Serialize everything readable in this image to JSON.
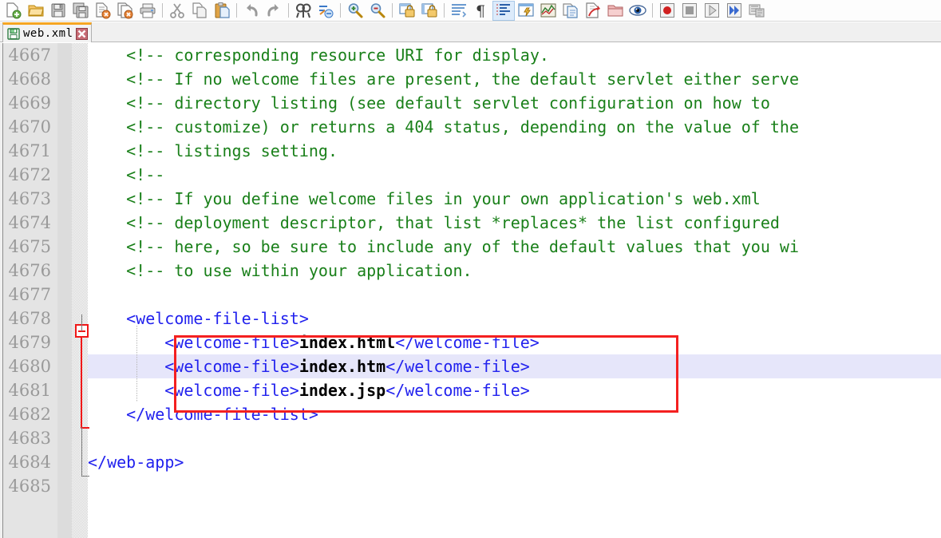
{
  "toolbar": {
    "groups": [
      {
        "buttons": [
          {
            "name": "new-file-icon",
            "title": "New"
          },
          {
            "name": "open-folder-icon",
            "title": "Open"
          },
          {
            "name": "save-icon",
            "title": "Save"
          },
          {
            "name": "save-all-icon",
            "title": "Save All"
          },
          {
            "name": "close-file-icon",
            "title": "Close"
          },
          {
            "name": "close-all-files-icon",
            "title": "Close All"
          },
          {
            "name": "print-icon",
            "title": "Print"
          }
        ]
      },
      {
        "buttons": [
          {
            "name": "cut-icon",
            "title": "Cut"
          },
          {
            "name": "copy-icon",
            "title": "Copy"
          },
          {
            "name": "paste-icon",
            "title": "Paste"
          }
        ]
      },
      {
        "buttons": [
          {
            "name": "undo-icon",
            "title": "Undo"
          },
          {
            "name": "redo-icon",
            "title": "Redo"
          }
        ]
      },
      {
        "buttons": [
          {
            "name": "find-icon",
            "title": "Find"
          },
          {
            "name": "replace-icon",
            "title": "Replace"
          }
        ]
      },
      {
        "buttons": [
          {
            "name": "zoom-in-icon",
            "title": "Zoom In"
          },
          {
            "name": "zoom-out-icon",
            "title": "Zoom Out"
          }
        ]
      },
      {
        "buttons": [
          {
            "name": "sync-vertical-scroll-icon",
            "title": "Synchronize Vertical Scrolling"
          },
          {
            "name": "sync-horizontal-scroll-icon",
            "title": "Synchronize Horizontal Scrolling"
          }
        ]
      },
      {
        "buttons": [
          {
            "name": "word-wrap-icon",
            "title": "Word wrap"
          },
          {
            "name": "show-all-characters-icon",
            "title": "Show All Characters"
          },
          {
            "name": "show-indent-guide-icon",
            "title": "Show Indent Guide",
            "selected": true
          },
          {
            "name": "user-defined-dialog-icon",
            "title": "User-Defined Dialogue"
          },
          {
            "name": "document-map-icon",
            "title": "Document Map"
          },
          {
            "name": "function-list-icon",
            "title": "Function List"
          },
          {
            "name": "document-switcher-icon",
            "title": "Document Switcher"
          },
          {
            "name": "folder-as-workspace-icon",
            "title": "Folder as Workspace"
          },
          {
            "name": "monitoring-icon",
            "title": "Monitoring"
          }
        ]
      },
      {
        "buttons": [
          {
            "name": "record-macro-icon",
            "title": "Start Recording"
          },
          {
            "name": "stop-macro-icon",
            "title": "Stop Recording"
          },
          {
            "name": "play-macro-icon",
            "title": "Playback"
          },
          {
            "name": "run-macro-multiple-icon",
            "title": "Run a Macro Multiple Times"
          },
          {
            "name": "save-macro-icon",
            "title": "Save Current Recorded Macro"
          }
        ]
      }
    ]
  },
  "tabs": [
    {
      "label": "web.xml",
      "icon": "saved-file-icon",
      "close": "close-tab-icon",
      "active": true
    }
  ],
  "editor": {
    "first_line": 4667,
    "highlighted_line": 4680,
    "annotation_box_color": "#f42020",
    "current_line_color": "#e6e6fa",
    "comment_color": "#1a801a",
    "tag_color": "#2222ee",
    "text_color": "#000000",
    "lines": [
      {
        "n": 4667,
        "indent": 0,
        "parts": [
          {
            "t": "comment",
            "s": "<!-- corresponding resource URI for display."
          }
        ]
      },
      {
        "n": 4668,
        "indent": 0,
        "parts": [
          {
            "t": "comment",
            "s": "<!-- If no welcome files are present, the default servlet either serve"
          }
        ]
      },
      {
        "n": 4669,
        "indent": 0,
        "parts": [
          {
            "t": "comment",
            "s": "<!-- directory listing (see default servlet configuration on how to"
          }
        ]
      },
      {
        "n": 4670,
        "indent": 0,
        "parts": [
          {
            "t": "comment",
            "s": "<!-- customize) or returns a 404 status, depending on the value of the"
          }
        ]
      },
      {
        "n": 4671,
        "indent": 0,
        "parts": [
          {
            "t": "comment",
            "s": "<!-- listings setting."
          }
        ]
      },
      {
        "n": 4672,
        "indent": 0,
        "parts": [
          {
            "t": "comment",
            "s": "<!--"
          }
        ]
      },
      {
        "n": 4673,
        "indent": 0,
        "parts": [
          {
            "t": "comment",
            "s": "<!-- If you define welcome files in your own application's web.xml"
          }
        ]
      },
      {
        "n": 4674,
        "indent": 0,
        "parts": [
          {
            "t": "comment",
            "s": "<!-- deployment descriptor, that list *replaces* the list configured"
          }
        ]
      },
      {
        "n": 4675,
        "indent": 0,
        "parts": [
          {
            "t": "comment",
            "s": "<!-- here, so be sure to include any of the default values that you wi"
          }
        ]
      },
      {
        "n": 4676,
        "indent": 0,
        "parts": [
          {
            "t": "comment",
            "s": "<!-- to use within your application."
          }
        ]
      },
      {
        "n": 4677,
        "indent": 0,
        "parts": []
      },
      {
        "n": 4678,
        "indent": 0,
        "parts": [
          {
            "t": "tag",
            "s": "<welcome-file-list>"
          }
        ]
      },
      {
        "n": 4679,
        "indent": 1,
        "parts": [
          {
            "t": "tag",
            "s": "<welcome-file>"
          },
          {
            "t": "text",
            "s": "index.html"
          },
          {
            "t": "tag",
            "s": "</welcome-file>"
          }
        ]
      },
      {
        "n": 4680,
        "indent": 1,
        "parts": [
          {
            "t": "tag",
            "s": "<welcome-file>"
          },
          {
            "t": "text",
            "s": "index.htm"
          },
          {
            "t": "tag",
            "s": "</welcome-file>"
          }
        ]
      },
      {
        "n": 4681,
        "indent": 1,
        "parts": [
          {
            "t": "tag",
            "s": "<welcome-file>"
          },
          {
            "t": "text",
            "s": "index.jsp"
          },
          {
            "t": "tag",
            "s": "</welcome-file>"
          }
        ]
      },
      {
        "n": 4682,
        "indent": 0,
        "parts": [
          {
            "t": "tag",
            "s": "</welcome-file-list>"
          }
        ]
      },
      {
        "n": 4683,
        "indent": 0,
        "parts": []
      },
      {
        "n": 4684,
        "indent": -1,
        "parts": [
          {
            "t": "tag",
            "s": "</web-app>"
          }
        ]
      },
      {
        "n": 4685,
        "indent": 0,
        "parts": []
      }
    ]
  }
}
